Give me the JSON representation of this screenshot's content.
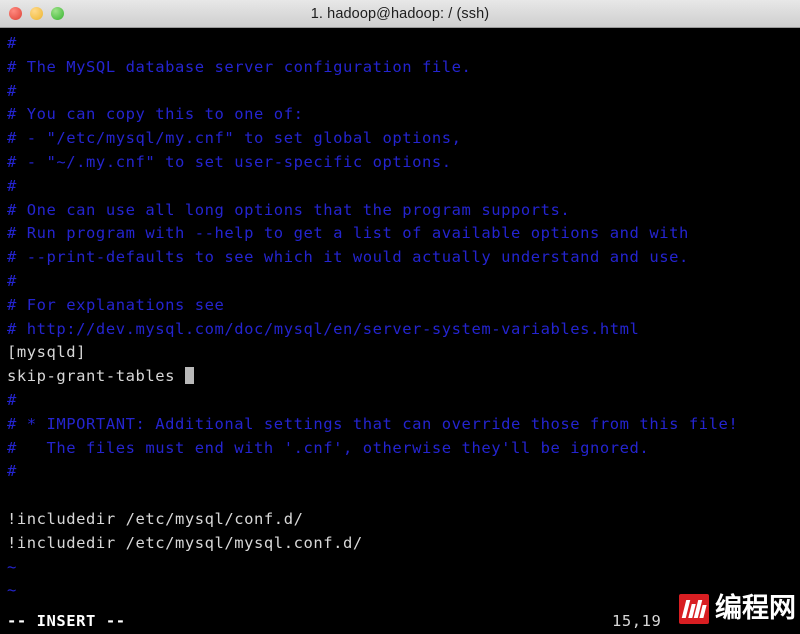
{
  "window": {
    "title": "1. hadoop@hadoop: / (ssh)",
    "controls": {
      "close_label": "",
      "minimize_label": "",
      "maximize_label": ""
    }
  },
  "terminal": {
    "background_color": "#000000",
    "comment_color": "#2424cf",
    "text_color": "#d8d8d8",
    "lines": [
      {
        "text": "#",
        "style": "comment"
      },
      {
        "text": "# The MySQL database server configuration file.",
        "style": "comment"
      },
      {
        "text": "#",
        "style": "comment"
      },
      {
        "text": "# You can copy this to one of:",
        "style": "comment"
      },
      {
        "text": "# - \"/etc/mysql/my.cnf\" to set global options,",
        "style": "comment"
      },
      {
        "text": "# - \"~/.my.cnf\" to set user-specific options.",
        "style": "comment"
      },
      {
        "text": "#",
        "style": "comment"
      },
      {
        "text": "# One can use all long options that the program supports.",
        "style": "comment"
      },
      {
        "text": "# Run program with --help to get a list of available options and with",
        "style": "comment"
      },
      {
        "text": "# --print-defaults to see which it would actually understand and use.",
        "style": "comment"
      },
      {
        "text": "#",
        "style": "comment"
      },
      {
        "text": "# For explanations see",
        "style": "comment"
      },
      {
        "text": "# http://dev.mysql.com/doc/mysql/en/server-system-variables.html",
        "style": "comment"
      },
      {
        "text": "[mysqld]",
        "style": "text"
      },
      {
        "text": "skip-grant-tables ",
        "style": "text",
        "cursor": true
      },
      {
        "text": "#",
        "style": "comment"
      },
      {
        "text": "# * IMPORTANT: Additional settings that can override those from this file!",
        "style": "comment"
      },
      {
        "text": "#   The files must end with '.cnf', otherwise they'll be ignored.",
        "style": "comment"
      },
      {
        "text": "#",
        "style": "comment"
      },
      {
        "text": "",
        "style": "blank"
      },
      {
        "text": "!includedir /etc/mysql/conf.d/",
        "style": "text"
      },
      {
        "text": "!includedir /etc/mysql/mysql.conf.d/",
        "style": "text"
      },
      {
        "text": "~",
        "style": "tilde"
      },
      {
        "text": "~",
        "style": "tilde"
      }
    ]
  },
  "statusline": {
    "mode": "-- INSERT --",
    "position": "15,19"
  },
  "watermark": {
    "logo_color": "#d81e22",
    "text": "编程网"
  }
}
